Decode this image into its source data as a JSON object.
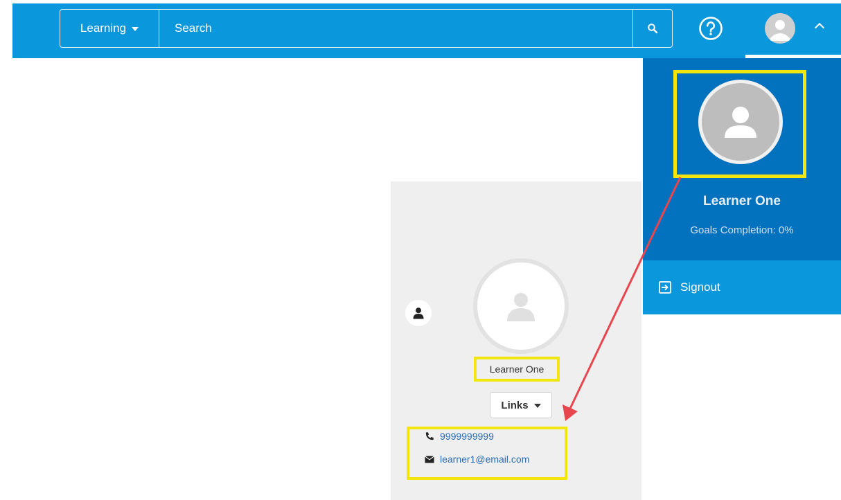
{
  "header": {
    "scope_label": "Learning",
    "search_placeholder": "Search",
    "icons": [
      "caret-down-icon",
      "search-icon",
      "help-icon",
      "avatar-icon",
      "chevron-up-icon"
    ]
  },
  "dropdown": {
    "name": "Learner One",
    "goals": "Goals Completion: 0%",
    "signout_label": "Signout",
    "signout_icon": "signout-icon"
  },
  "profile_card": {
    "name": "Learner One",
    "links_label": "Links",
    "phone": "9999999999",
    "email": "learner1@email.com",
    "icons": [
      "user-icon",
      "avatar-placeholder-icon",
      "phone-icon",
      "envelope-icon"
    ]
  },
  "colors": {
    "topbar": "#0a97dc",
    "dropdown": "#0272bf",
    "highlight": "#f3e60e",
    "arrow": "#e8464f",
    "link": "#2a6db5"
  }
}
